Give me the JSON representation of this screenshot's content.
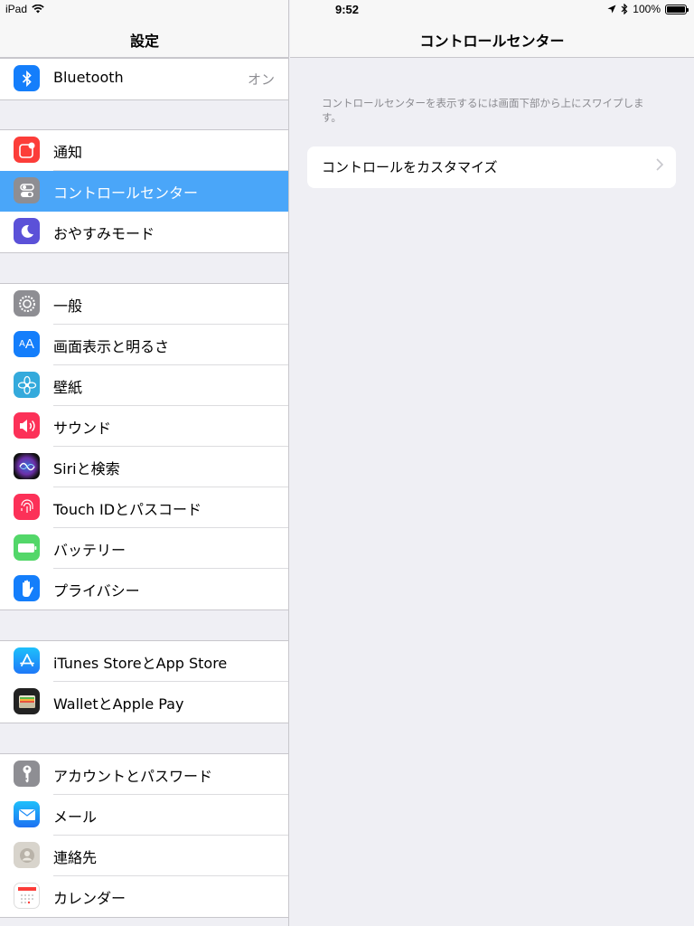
{
  "status_bar": {
    "device": "iPad",
    "time": "9:52",
    "battery": "100%"
  },
  "left": {
    "title": "設定",
    "group1": [
      {
        "label": "Bluetooth",
        "value": "オン",
        "icon": "bluetooth-icon",
        "color": "#147efb"
      }
    ],
    "group2": [
      {
        "label": "通知",
        "icon": "notifications-icon",
        "color": "#fc3d39"
      },
      {
        "label": "コントロールセンター",
        "icon": "control-center-icon",
        "color": "#8e8e93",
        "selected": true
      },
      {
        "label": "おやすみモード",
        "icon": "moon-icon",
        "color": "#5b51d8"
      }
    ],
    "group3": [
      {
        "label": "一般",
        "icon": "gear-icon",
        "color": "#8e8e93"
      },
      {
        "label": "画面表示と明るさ",
        "icon": "display-aa-icon",
        "color": "#147efb",
        "glyph": "AA"
      },
      {
        "label": "壁紙",
        "icon": "wallpaper-flower-icon",
        "color": "#34aadc"
      },
      {
        "label": "サウンド",
        "icon": "speaker-icon",
        "color": "#fc3158"
      },
      {
        "label": "Siriと検索",
        "icon": "siri-icon",
        "color": "#222244"
      },
      {
        "label": "Touch IDとパスコード",
        "icon": "fingerprint-icon",
        "color": "#fc3158"
      },
      {
        "label": "バッテリー",
        "icon": "battery-icon",
        "color": "#53d769"
      },
      {
        "label": "プライバシー",
        "icon": "hand-icon",
        "color": "#147efb"
      }
    ],
    "group4": [
      {
        "label": "iTunes StoreとApp Store",
        "icon": "app-store-icon",
        "color": "#1e8ef8"
      },
      {
        "label": "WalletとApple Pay",
        "icon": "wallet-icon",
        "color": "#222222"
      }
    ],
    "group5": [
      {
        "label": "アカウントとパスワード",
        "icon": "key-icon",
        "color": "#8e8e93"
      },
      {
        "label": "メール",
        "icon": "mail-icon",
        "color": "#1d8cf8"
      },
      {
        "label": "連絡先",
        "icon": "contacts-icon",
        "color": "#c9c5be"
      },
      {
        "label": "カレンダー",
        "icon": "calendar-icon",
        "color": "#ffffff"
      }
    ]
  },
  "right": {
    "title": "コントロールセンター",
    "description": "コントロールセンターを表示するには画面下部から上にスワイプします。",
    "customize_label": "コントロールをカスタマイズ"
  }
}
